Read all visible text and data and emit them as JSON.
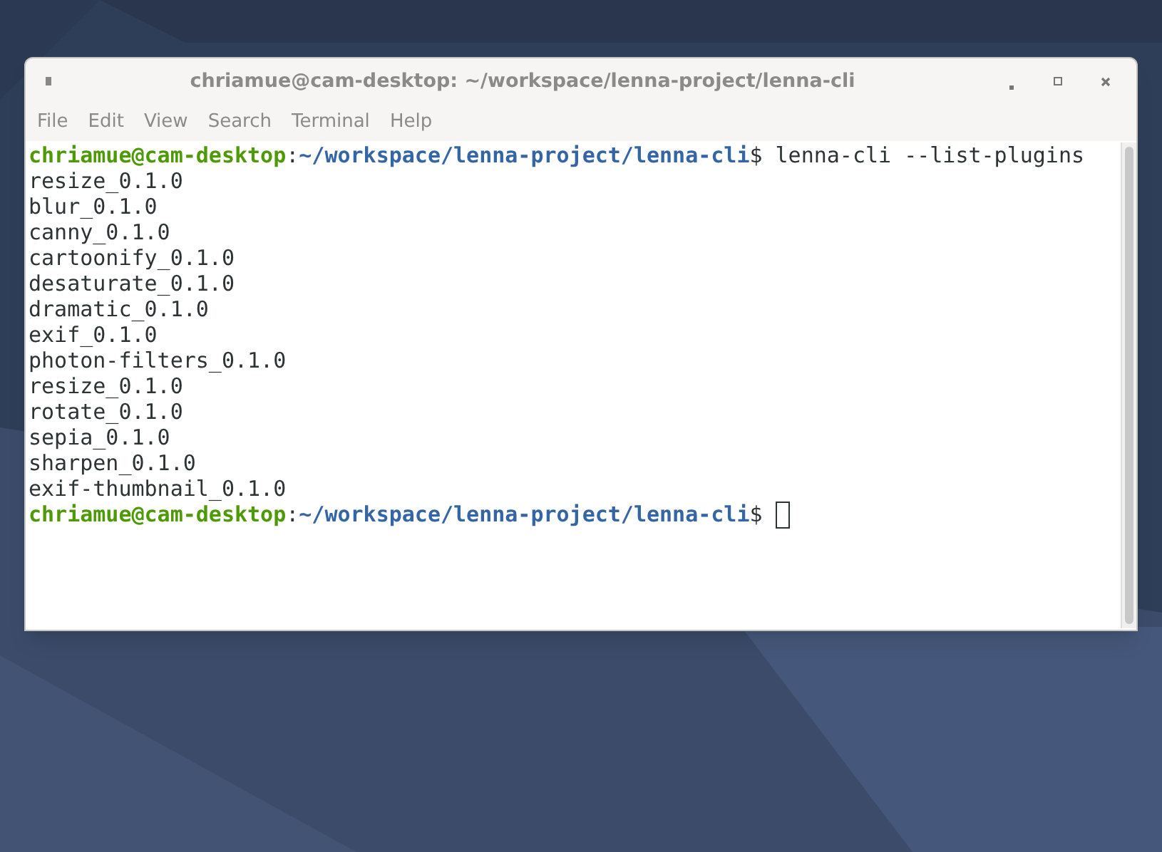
{
  "window": {
    "title": "chriamue@cam-desktop: ~/workspace/lenna-project/lenna-cli",
    "controls": [
      {
        "kind": "minimize"
      },
      {
        "kind": "maximize"
      },
      {
        "kind": "close"
      }
    ]
  },
  "menu": [
    "File",
    "Edit",
    "View",
    "Search",
    "Terminal",
    "Help"
  ],
  "terminal": {
    "lines": [
      {
        "kind": "prompt",
        "user": "chriamue@cam-desktop",
        "separator": ":",
        "path": "~/workspace/lenna-project/lenna-cli",
        "symbol": "$",
        "command": "lenna-cli --list-plugins",
        "cursor": false
      },
      {
        "kind": "output",
        "text": "resize_0.1.0"
      },
      {
        "kind": "output",
        "text": "blur_0.1.0"
      },
      {
        "kind": "output",
        "text": "canny_0.1.0"
      },
      {
        "kind": "output",
        "text": "cartoonify_0.1.0"
      },
      {
        "kind": "output",
        "text": "desaturate_0.1.0"
      },
      {
        "kind": "output",
        "text": "dramatic_0.1.0"
      },
      {
        "kind": "output",
        "text": "exif_0.1.0"
      },
      {
        "kind": "output",
        "text": "photon-filters_0.1.0"
      },
      {
        "kind": "output",
        "text": "resize_0.1.0"
      },
      {
        "kind": "output",
        "text": "rotate_0.1.0"
      },
      {
        "kind": "output",
        "text": "sepia_0.1.0"
      },
      {
        "kind": "output",
        "text": "sharpen_0.1.0"
      },
      {
        "kind": "output",
        "text": "exif-thumbnail_0.1.0"
      },
      {
        "kind": "prompt",
        "user": "chriamue@cam-desktop",
        "separator": ":",
        "path": "~/workspace/lenna-project/lenna-cli",
        "symbol": "$",
        "cursor": true
      }
    ]
  }
}
